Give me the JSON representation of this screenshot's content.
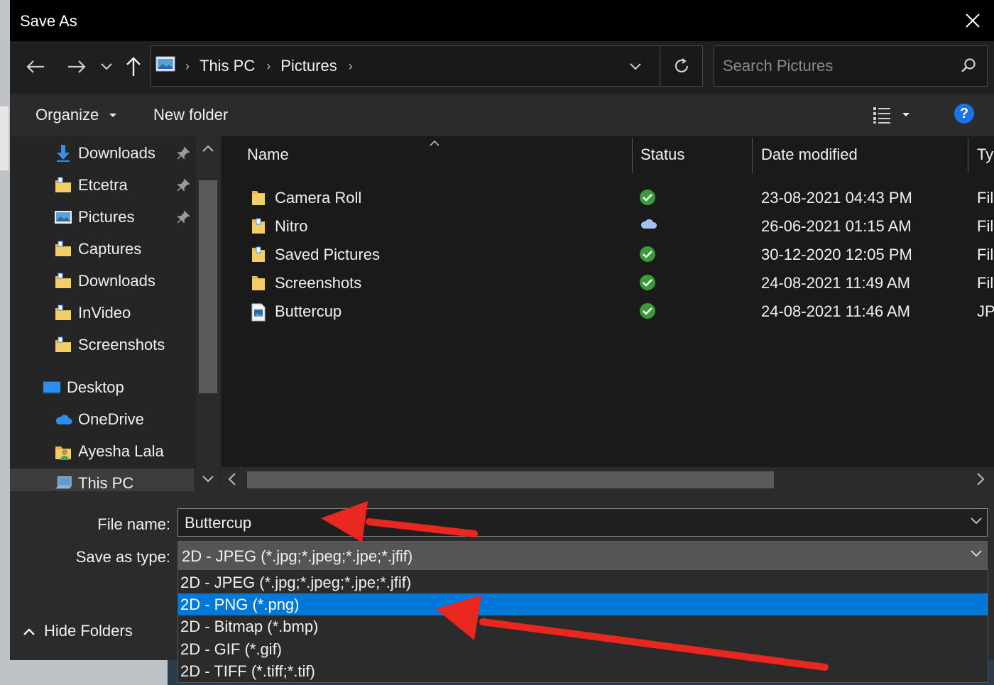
{
  "window": {
    "title": "Save As"
  },
  "nav": {
    "breadcrumbs": [
      "This PC",
      "Pictures"
    ],
    "search_placeholder": "Search Pictures"
  },
  "toolbar": {
    "organize": "Organize",
    "new_folder": "New folder",
    "help": "?"
  },
  "sidebar": {
    "items": [
      {
        "label": "Downloads",
        "icon": "download-arrow-icon",
        "pinned": true
      },
      {
        "label": "Etcetra",
        "icon": "folder-icon",
        "pinned": true
      },
      {
        "label": "Pictures",
        "icon": "pictures-icon",
        "pinned": true
      },
      {
        "label": "Captures",
        "icon": "folder-icon",
        "pinned": false
      },
      {
        "label": "Downloads",
        "icon": "folder-icon",
        "pinned": false
      },
      {
        "label": "InVideo",
        "icon": "folder-icon",
        "pinned": false
      },
      {
        "label": "Screenshots",
        "icon": "folder-icon",
        "pinned": false
      },
      {
        "label": "Desktop",
        "icon": "desktop-icon",
        "pinned": false
      },
      {
        "label": "OneDrive",
        "icon": "cloud-icon",
        "pinned": false
      },
      {
        "label": "Ayesha Lala",
        "icon": "user-folder-icon",
        "pinned": false
      },
      {
        "label": "This PC",
        "icon": "computer-icon",
        "pinned": false
      }
    ]
  },
  "filelist": {
    "columns": [
      "Name",
      "Status",
      "Date modified",
      "Type"
    ],
    "rows": [
      {
        "name": "Camera Roll",
        "status": "synced",
        "date": "23-08-2021 04:43 PM",
        "type": "File folder"
      },
      {
        "name": "Nitro",
        "status": "cloud",
        "date": "26-06-2021 01:15 AM",
        "type": "File folder"
      },
      {
        "name": "Saved Pictures",
        "status": "synced",
        "date": "30-12-2020 12:05 PM",
        "type": "File folder"
      },
      {
        "name": "Screenshots",
        "status": "synced",
        "date": "24-08-2021 11:49 AM",
        "type": "File folder"
      },
      {
        "name": "Buttercup",
        "status": "synced",
        "date": "24-08-2021 11:46 AM",
        "type": "JPG File"
      }
    ]
  },
  "form": {
    "file_name_label": "File name:",
    "file_name_value": "Buttercup",
    "save_type_label": "Save as type:",
    "save_type_value": "2D - JPEG (*.jpg;*.jpeg;*.jpe;*.jfif)",
    "hide_folders": "Hide Folders"
  },
  "type_options": [
    "2D - JPEG (*.jpg;*.jpeg;*.jpe;*.jfif)",
    "2D - PNG (*.png)",
    "2D - Bitmap (*.bmp)",
    "2D - GIF (*.gif)",
    "2D - TIFF (*.tiff;*.tif)"
  ],
  "selected_option_index": 1,
  "colors": {
    "accent": "#0078d7",
    "annotation_arrow": "#e8281e",
    "sync_green": "#3c9a3c"
  }
}
